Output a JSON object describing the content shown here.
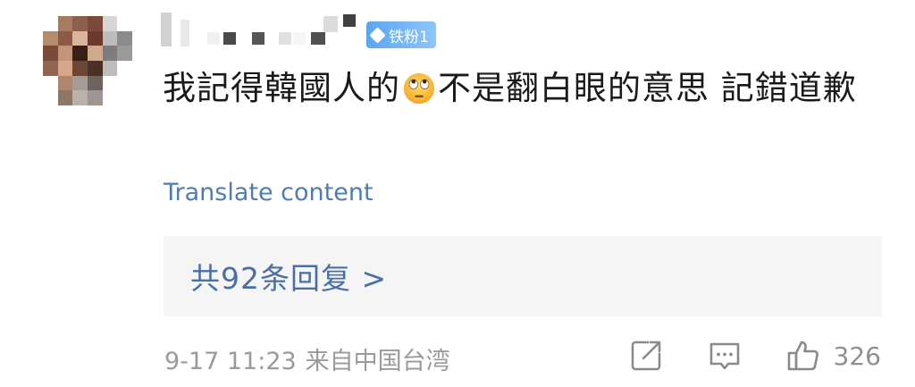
{
  "comment": {
    "badge_label": "铁粉1",
    "text_part1": "我記得韓國人的",
    "text_emoji": "face-with-rolling-eyes-emoji",
    "text_part2": "不是翻白眼的意思 記錯道歉",
    "translate_label": "Translate content",
    "replies_label": "共92条回复 >",
    "timestamp": "9-17 11:23",
    "location": "来自中国台湾",
    "like_count": "326"
  },
  "icons": {
    "repost": "share-icon",
    "comment": "comment-icon",
    "like": "thumbs-up-icon"
  },
  "colors": {
    "link_blue": "#4f7db0",
    "reply_blue": "#4a6fa5",
    "badge_blue": "#5aa5f2",
    "reply_bg": "#f5f5f5",
    "meta_gray": "#9a9a9a"
  }
}
